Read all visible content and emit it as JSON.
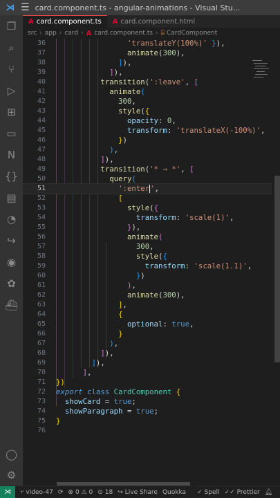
{
  "titlebar": {
    "title": "card.component.ts - angular-animations - Visual Stu...",
    "logo": "vscode-logo",
    "menu": "menu-icon"
  },
  "activity_bar": {
    "items": [
      "explorer-icon",
      "search-icon",
      "source-control-icon",
      "run-debug-icon",
      "extensions-icon",
      "remote-explorer-icon",
      "nx-console-icon",
      "json-icon",
      "clipboard-icon",
      "git-graph-icon",
      "live-share-icon",
      "github-icon",
      "settings-sync-icon",
      "docker-icon"
    ],
    "bottom": [
      "account-icon",
      "manage-gear-icon"
    ]
  },
  "tabs": [
    {
      "label": "card.component.ts",
      "active": true
    },
    {
      "label": "card.component.html",
      "active": false
    }
  ],
  "breadcrumb": [
    "src",
    "app",
    "card",
    "card.component.ts",
    "CardComponent"
  ],
  "editor": {
    "first_line": 36,
    "current_line": 51
  },
  "status": {
    "remote_icon": "remote-icon",
    "branch": "video-47",
    "sync_icon": "sync-icon",
    "problems": "0 ⚠ 0",
    "ports": "18",
    "live_share": "Live Share",
    "quokka": "Quokka",
    "spell": "Spell",
    "prettier": "Prettier",
    "accent": "#16825d"
  },
  "colors": {
    "string": "#ce9178",
    "number": "#b5cea8",
    "function": "#dcdcaa",
    "property": "#9cdcfe",
    "keyword": "#569cd6",
    "class": "#4ec9b0"
  }
}
